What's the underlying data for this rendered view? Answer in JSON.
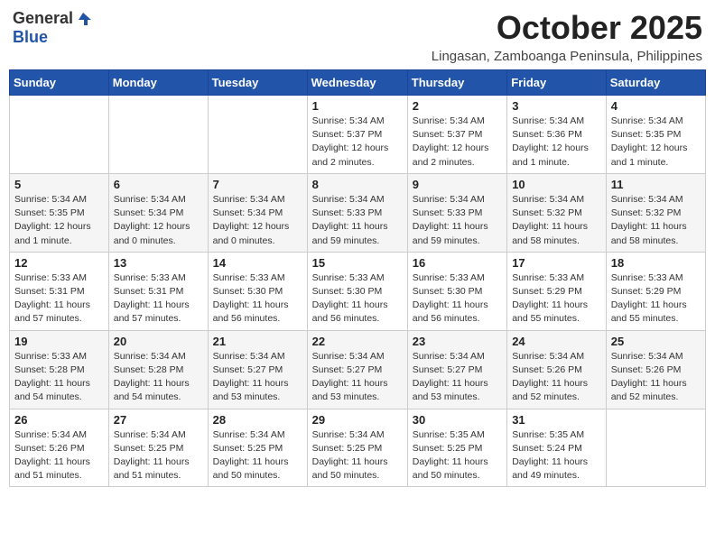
{
  "header": {
    "logo_general": "General",
    "logo_blue": "Blue",
    "month_title": "October 2025",
    "location": "Lingasan, Zamboanga Peninsula, Philippines"
  },
  "weekdays": [
    "Sunday",
    "Monday",
    "Tuesday",
    "Wednesday",
    "Thursday",
    "Friday",
    "Saturday"
  ],
  "weeks": [
    [
      {
        "day": "",
        "info": ""
      },
      {
        "day": "",
        "info": ""
      },
      {
        "day": "",
        "info": ""
      },
      {
        "day": "1",
        "info": "Sunrise: 5:34 AM\nSunset: 5:37 PM\nDaylight: 12 hours\nand 2 minutes."
      },
      {
        "day": "2",
        "info": "Sunrise: 5:34 AM\nSunset: 5:37 PM\nDaylight: 12 hours\nand 2 minutes."
      },
      {
        "day": "3",
        "info": "Sunrise: 5:34 AM\nSunset: 5:36 PM\nDaylight: 12 hours\nand 1 minute."
      },
      {
        "day": "4",
        "info": "Sunrise: 5:34 AM\nSunset: 5:35 PM\nDaylight: 12 hours\nand 1 minute."
      }
    ],
    [
      {
        "day": "5",
        "info": "Sunrise: 5:34 AM\nSunset: 5:35 PM\nDaylight: 12 hours\nand 1 minute."
      },
      {
        "day": "6",
        "info": "Sunrise: 5:34 AM\nSunset: 5:34 PM\nDaylight: 12 hours\nand 0 minutes."
      },
      {
        "day": "7",
        "info": "Sunrise: 5:34 AM\nSunset: 5:34 PM\nDaylight: 12 hours\nand 0 minutes."
      },
      {
        "day": "8",
        "info": "Sunrise: 5:34 AM\nSunset: 5:33 PM\nDaylight: 11 hours\nand 59 minutes."
      },
      {
        "day": "9",
        "info": "Sunrise: 5:34 AM\nSunset: 5:33 PM\nDaylight: 11 hours\nand 59 minutes."
      },
      {
        "day": "10",
        "info": "Sunrise: 5:34 AM\nSunset: 5:32 PM\nDaylight: 11 hours\nand 58 minutes."
      },
      {
        "day": "11",
        "info": "Sunrise: 5:34 AM\nSunset: 5:32 PM\nDaylight: 11 hours\nand 58 minutes."
      }
    ],
    [
      {
        "day": "12",
        "info": "Sunrise: 5:33 AM\nSunset: 5:31 PM\nDaylight: 11 hours\nand 57 minutes."
      },
      {
        "day": "13",
        "info": "Sunrise: 5:33 AM\nSunset: 5:31 PM\nDaylight: 11 hours\nand 57 minutes."
      },
      {
        "day": "14",
        "info": "Sunrise: 5:33 AM\nSunset: 5:30 PM\nDaylight: 11 hours\nand 56 minutes."
      },
      {
        "day": "15",
        "info": "Sunrise: 5:33 AM\nSunset: 5:30 PM\nDaylight: 11 hours\nand 56 minutes."
      },
      {
        "day": "16",
        "info": "Sunrise: 5:33 AM\nSunset: 5:30 PM\nDaylight: 11 hours\nand 56 minutes."
      },
      {
        "day": "17",
        "info": "Sunrise: 5:33 AM\nSunset: 5:29 PM\nDaylight: 11 hours\nand 55 minutes."
      },
      {
        "day": "18",
        "info": "Sunrise: 5:33 AM\nSunset: 5:29 PM\nDaylight: 11 hours\nand 55 minutes."
      }
    ],
    [
      {
        "day": "19",
        "info": "Sunrise: 5:33 AM\nSunset: 5:28 PM\nDaylight: 11 hours\nand 54 minutes."
      },
      {
        "day": "20",
        "info": "Sunrise: 5:34 AM\nSunset: 5:28 PM\nDaylight: 11 hours\nand 54 minutes."
      },
      {
        "day": "21",
        "info": "Sunrise: 5:34 AM\nSunset: 5:27 PM\nDaylight: 11 hours\nand 53 minutes."
      },
      {
        "day": "22",
        "info": "Sunrise: 5:34 AM\nSunset: 5:27 PM\nDaylight: 11 hours\nand 53 minutes."
      },
      {
        "day": "23",
        "info": "Sunrise: 5:34 AM\nSunset: 5:27 PM\nDaylight: 11 hours\nand 53 minutes."
      },
      {
        "day": "24",
        "info": "Sunrise: 5:34 AM\nSunset: 5:26 PM\nDaylight: 11 hours\nand 52 minutes."
      },
      {
        "day": "25",
        "info": "Sunrise: 5:34 AM\nSunset: 5:26 PM\nDaylight: 11 hours\nand 52 minutes."
      }
    ],
    [
      {
        "day": "26",
        "info": "Sunrise: 5:34 AM\nSunset: 5:26 PM\nDaylight: 11 hours\nand 51 minutes."
      },
      {
        "day": "27",
        "info": "Sunrise: 5:34 AM\nSunset: 5:25 PM\nDaylight: 11 hours\nand 51 minutes."
      },
      {
        "day": "28",
        "info": "Sunrise: 5:34 AM\nSunset: 5:25 PM\nDaylight: 11 hours\nand 50 minutes."
      },
      {
        "day": "29",
        "info": "Sunrise: 5:34 AM\nSunset: 5:25 PM\nDaylight: 11 hours\nand 50 minutes."
      },
      {
        "day": "30",
        "info": "Sunrise: 5:35 AM\nSunset: 5:25 PM\nDaylight: 11 hours\nand 50 minutes."
      },
      {
        "day": "31",
        "info": "Sunrise: 5:35 AM\nSunset: 5:24 PM\nDaylight: 11 hours\nand 49 minutes."
      },
      {
        "day": "",
        "info": ""
      }
    ]
  ]
}
